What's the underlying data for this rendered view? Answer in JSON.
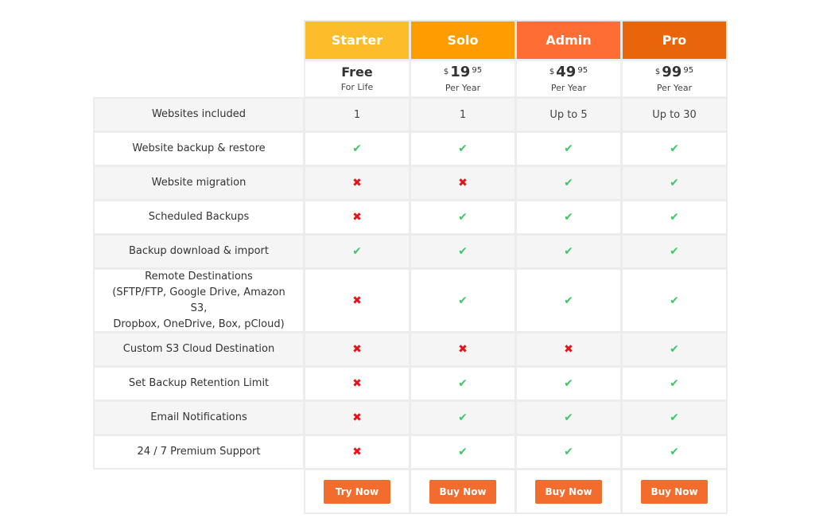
{
  "plans": [
    {
      "name": "Starter",
      "color": "#fdbd2a",
      "price_text": "Free",
      "period": "For Life",
      "button": "Try Now"
    },
    {
      "name": "Solo",
      "color": "#fe9c00",
      "currency": "$",
      "whole": "19",
      "cents": "95",
      "period": "Per Year",
      "button": "Buy Now"
    },
    {
      "name": "Admin",
      "color": "#fe6d33",
      "currency": "$",
      "whole": "49",
      "cents": "95",
      "period": "Per Year",
      "button": "Buy Now"
    },
    {
      "name": "Pro",
      "color": "#e8650a",
      "currency": "$",
      "whole": "99",
      "cents": "95",
      "period": "Per Year",
      "button": "Buy Now"
    }
  ],
  "features": [
    {
      "label": "Websites included",
      "values": [
        "1",
        "1",
        "Up to 5",
        "Up to 30"
      ]
    },
    {
      "label": "Website backup & restore",
      "values": [
        "yes",
        "yes",
        "yes",
        "yes"
      ]
    },
    {
      "label": "Website migration",
      "values": [
        "no",
        "no",
        "yes",
        "yes"
      ]
    },
    {
      "label": "Scheduled Backups",
      "values": [
        "no",
        "yes",
        "yes",
        "yes"
      ]
    },
    {
      "label": "Backup download & import",
      "values": [
        "yes",
        "yes",
        "yes",
        "yes"
      ]
    },
    {
      "label_lines": [
        "Remote Destinations",
        "(SFTP/FTP, Google Drive, Amazon S3,",
        "Dropbox, OneDrive, Box, pCloud)"
      ],
      "values": [
        "no",
        "yes",
        "yes",
        "yes"
      ]
    },
    {
      "label": "Custom S3 Cloud Destination",
      "values": [
        "no",
        "no",
        "no",
        "yes"
      ]
    },
    {
      "label": "Set Backup Retention Limit",
      "values": [
        "no",
        "yes",
        "yes",
        "yes"
      ]
    },
    {
      "label": "Email Notifications",
      "values": [
        "no",
        "yes",
        "yes",
        "yes"
      ]
    },
    {
      "label": "24 / 7 Premium Support",
      "values": [
        "no",
        "yes",
        "yes",
        "yes"
      ]
    }
  ],
  "icons": {
    "yes": "check-icon",
    "no": "cross-icon"
  }
}
